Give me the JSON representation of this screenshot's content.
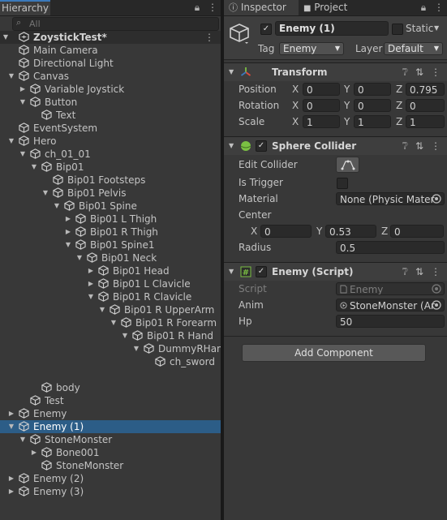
{
  "hierarchy": {
    "tab_label": "Hierarchy",
    "search_placeholder": "All",
    "scene_name": "ZoystickTest*",
    "items": [
      {
        "label": "Main Camera",
        "arrow": "",
        "depth": 1
      },
      {
        "label": "Directional Light",
        "arrow": "",
        "depth": 1
      },
      {
        "label": "Canvas",
        "arrow": "down",
        "depth": 1
      },
      {
        "label": "Variable Joystick",
        "arrow": "right",
        "depth": 2
      },
      {
        "label": "Button",
        "arrow": "down",
        "depth": 2
      },
      {
        "label": "Text",
        "arrow": "",
        "depth": 3
      },
      {
        "label": "EventSystem",
        "arrow": "",
        "depth": 1
      },
      {
        "label": "Hero",
        "arrow": "down",
        "depth": 1
      },
      {
        "label": "ch_01_01",
        "arrow": "down",
        "depth": 2
      },
      {
        "label": "Bip01",
        "arrow": "down",
        "depth": 3
      },
      {
        "label": "Bip01 Footsteps",
        "arrow": "",
        "depth": 4
      },
      {
        "label": "Bip01 Pelvis",
        "arrow": "down",
        "depth": 4
      },
      {
        "label": "Bip01 Spine",
        "arrow": "down",
        "depth": 5
      },
      {
        "label": "Bip01 L Thigh",
        "arrow": "right",
        "depth": 6
      },
      {
        "label": "Bip01 R Thigh",
        "arrow": "right",
        "depth": 6
      },
      {
        "label": "Bip01 Spine1",
        "arrow": "down",
        "depth": 6
      },
      {
        "label": "Bip01 Neck",
        "arrow": "down",
        "depth": 7
      },
      {
        "label": "Bip01 Head",
        "arrow": "right",
        "depth": 8
      },
      {
        "label": "Bip01 L Clavicle",
        "arrow": "right",
        "depth": 8
      },
      {
        "label": "Bip01 R Clavicle",
        "arrow": "down",
        "depth": 8
      },
      {
        "label": "Bip01 R UpperArm",
        "arrow": "down",
        "depth": 9
      },
      {
        "label": "Bip01 R Forearm",
        "arrow": "down",
        "depth": 10
      },
      {
        "label": "Bip01 R Hand",
        "arrow": "down",
        "depth": 11
      },
      {
        "label": "DummyRHand",
        "arrow": "down",
        "depth": 12
      },
      {
        "label": "ch_sword",
        "arrow": "",
        "depth": 13
      },
      {
        "label": "",
        "arrow": "",
        "depth": 0
      },
      {
        "label": "body",
        "arrow": "",
        "depth": 3
      },
      {
        "label": "Test",
        "arrow": "",
        "depth": 2
      },
      {
        "label": "Enemy",
        "arrow": "right",
        "depth": 1
      },
      {
        "label": "Enemy (1)",
        "arrow": "down",
        "depth": 1,
        "selected": true
      },
      {
        "label": "StoneMonster",
        "arrow": "down",
        "depth": 2
      },
      {
        "label": "Bone001",
        "arrow": "right",
        "depth": 3
      },
      {
        "label": "StoneMonster",
        "arrow": "",
        "depth": 3
      },
      {
        "label": "Enemy (2)",
        "arrow": "right",
        "depth": 1
      },
      {
        "label": "Enemy (3)",
        "arrow": "right",
        "depth": 1
      }
    ]
  },
  "inspector": {
    "tabs": [
      {
        "label": "Inspector",
        "icon": "info-icon"
      },
      {
        "label": "Project",
        "icon": "folder-icon"
      }
    ],
    "object_name": "Enemy (1)",
    "static_label": "Static",
    "tag_label": "Tag",
    "tag_value": "Enemy",
    "layer_label": "Layer",
    "layer_value": "Default",
    "transform": {
      "title": "Transform",
      "position_label": "Position",
      "rotation_label": "Rotation",
      "scale_label": "Scale",
      "position": {
        "x": "0",
        "y": "0",
        "z": "0.795"
      },
      "rotation": {
        "x": "0",
        "y": "0",
        "z": "0"
      },
      "scale": {
        "x": "1",
        "y": "1",
        "z": "1"
      },
      "x_label": "X",
      "y_label": "Y",
      "z_label": "Z"
    },
    "sphere_collider": {
      "title": "Sphere Collider",
      "edit_collider_label": "Edit Collider",
      "is_trigger_label": "Is Trigger",
      "material_label": "Material",
      "material_value": "None (Physic Mater",
      "center_label": "Center",
      "center": {
        "x": "0",
        "y": "0.53",
        "z": "0"
      },
      "radius_label": "Radius",
      "radius_value": "0.5"
    },
    "enemy_script": {
      "title": "Enemy (Script)",
      "script_label": "Script",
      "script_value": "Enemy",
      "anim_label": "Anim",
      "anim_value": "StoneMonster (Ar",
      "hp_label": "Hp",
      "hp_value": "50"
    },
    "add_component_label": "Add Component"
  },
  "colors": {
    "selection": "#2c5d87",
    "panel": "#383838",
    "accent": "#3a79bb"
  }
}
